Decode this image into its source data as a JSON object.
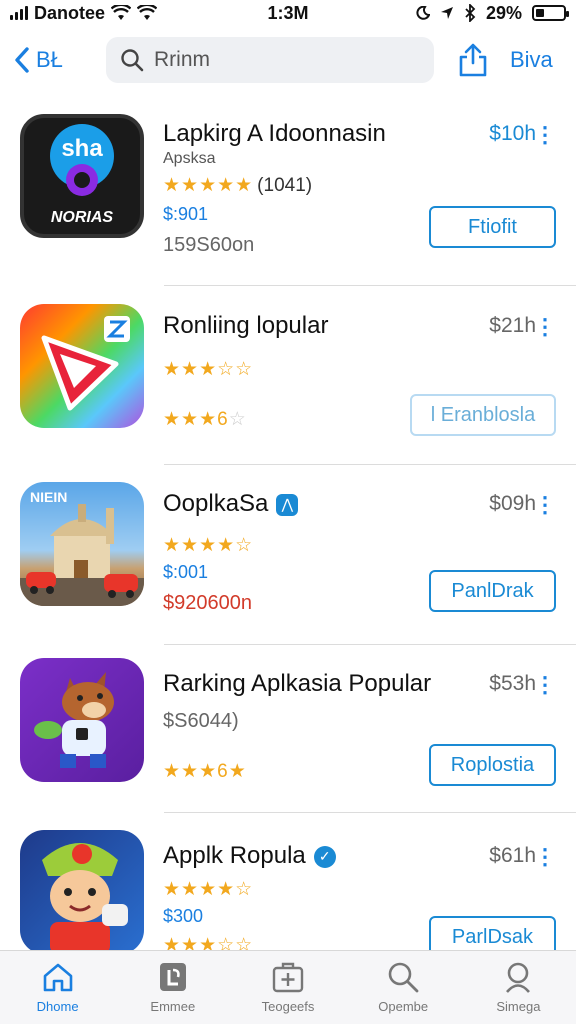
{
  "status_bar": {
    "carrier": "Danotee",
    "time": "1:3M",
    "battery": "29%",
    "battery_level": 0.29
  },
  "nav": {
    "back_label": "BŁ",
    "search_placeholder": "Rrinm",
    "right_label": "Biva"
  },
  "apps": [
    {
      "title": "Lapkirg A Idoonnasin",
      "subtitle": "Apsksa",
      "price": "$10h",
      "rating": 5,
      "rating_count": "(1041)",
      "meta1": "$:901",
      "meta2": "159S60on",
      "button": "Ftiofit",
      "icon_text_top": "sha",
      "icon_text_bottom": "NORIAS"
    },
    {
      "title": "Ronliing lopular",
      "price": "$21h",
      "rating": 3,
      "rating2": 3,
      "rating2_suffix": "6",
      "button": "l Eranblosla"
    },
    {
      "title": "OoplkaSa",
      "price": "$09h",
      "rating": 4,
      "meta1": "$:001",
      "meta2": "$920600n",
      "button": "PanlDrak",
      "icon_text": "NIEIN"
    },
    {
      "title": "Rarking Aplkasia Popular",
      "price": "$53h",
      "meta1": "$S6044)",
      "rating": 3,
      "rating_suffix": "6",
      "button": "Roplostia"
    },
    {
      "title": "Applk Ropula",
      "price": "$61h",
      "rating": 4,
      "meta1": "$300",
      "button": "ParlDsak"
    }
  ],
  "tabs": [
    {
      "label": "Dhome",
      "icon": "home-icon"
    },
    {
      "label": "Emmee",
      "icon": "apps-icon"
    },
    {
      "label": "Teogeefs",
      "icon": "bag-plus-icon"
    },
    {
      "label": "Opembe",
      "icon": "search-icon"
    },
    {
      "label": "Simega",
      "icon": "search-icon-2"
    }
  ],
  "colors": {
    "accent": "#1a7fe0",
    "star": "#f2a81e",
    "price_red": "#d23b2a"
  }
}
